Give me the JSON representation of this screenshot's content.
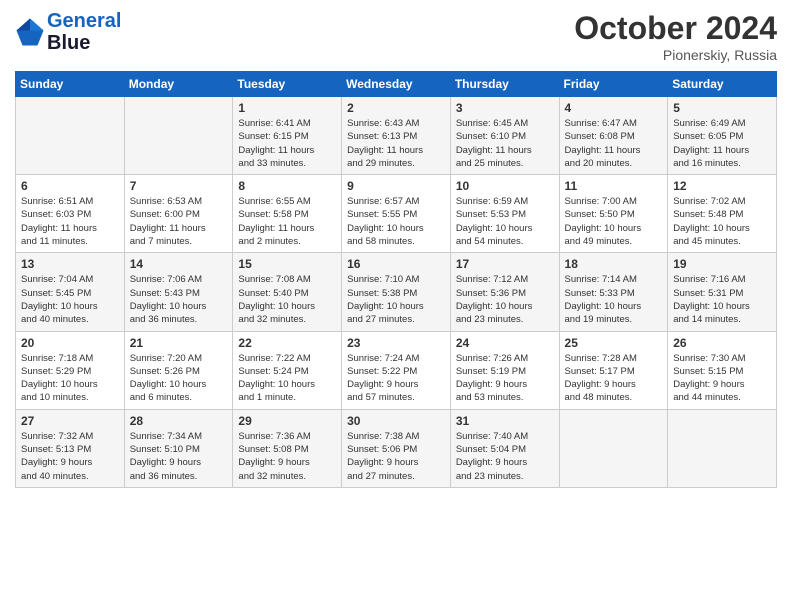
{
  "logo": {
    "line1": "General",
    "line2": "Blue"
  },
  "title": "October 2024",
  "location": "Pionerskiy, Russia",
  "days_header": [
    "Sunday",
    "Monday",
    "Tuesday",
    "Wednesday",
    "Thursday",
    "Friday",
    "Saturday"
  ],
  "weeks": [
    [
      {
        "num": "",
        "info": ""
      },
      {
        "num": "",
        "info": ""
      },
      {
        "num": "1",
        "info": "Sunrise: 6:41 AM\nSunset: 6:15 PM\nDaylight: 11 hours\nand 33 minutes."
      },
      {
        "num": "2",
        "info": "Sunrise: 6:43 AM\nSunset: 6:13 PM\nDaylight: 11 hours\nand 29 minutes."
      },
      {
        "num": "3",
        "info": "Sunrise: 6:45 AM\nSunset: 6:10 PM\nDaylight: 11 hours\nand 25 minutes."
      },
      {
        "num": "4",
        "info": "Sunrise: 6:47 AM\nSunset: 6:08 PM\nDaylight: 11 hours\nand 20 minutes."
      },
      {
        "num": "5",
        "info": "Sunrise: 6:49 AM\nSunset: 6:05 PM\nDaylight: 11 hours\nand 16 minutes."
      }
    ],
    [
      {
        "num": "6",
        "info": "Sunrise: 6:51 AM\nSunset: 6:03 PM\nDaylight: 11 hours\nand 11 minutes."
      },
      {
        "num": "7",
        "info": "Sunrise: 6:53 AM\nSunset: 6:00 PM\nDaylight: 11 hours\nand 7 minutes."
      },
      {
        "num": "8",
        "info": "Sunrise: 6:55 AM\nSunset: 5:58 PM\nDaylight: 11 hours\nand 2 minutes."
      },
      {
        "num": "9",
        "info": "Sunrise: 6:57 AM\nSunset: 5:55 PM\nDaylight: 10 hours\nand 58 minutes."
      },
      {
        "num": "10",
        "info": "Sunrise: 6:59 AM\nSunset: 5:53 PM\nDaylight: 10 hours\nand 54 minutes."
      },
      {
        "num": "11",
        "info": "Sunrise: 7:00 AM\nSunset: 5:50 PM\nDaylight: 10 hours\nand 49 minutes."
      },
      {
        "num": "12",
        "info": "Sunrise: 7:02 AM\nSunset: 5:48 PM\nDaylight: 10 hours\nand 45 minutes."
      }
    ],
    [
      {
        "num": "13",
        "info": "Sunrise: 7:04 AM\nSunset: 5:45 PM\nDaylight: 10 hours\nand 40 minutes."
      },
      {
        "num": "14",
        "info": "Sunrise: 7:06 AM\nSunset: 5:43 PM\nDaylight: 10 hours\nand 36 minutes."
      },
      {
        "num": "15",
        "info": "Sunrise: 7:08 AM\nSunset: 5:40 PM\nDaylight: 10 hours\nand 32 minutes."
      },
      {
        "num": "16",
        "info": "Sunrise: 7:10 AM\nSunset: 5:38 PM\nDaylight: 10 hours\nand 27 minutes."
      },
      {
        "num": "17",
        "info": "Sunrise: 7:12 AM\nSunset: 5:36 PM\nDaylight: 10 hours\nand 23 minutes."
      },
      {
        "num": "18",
        "info": "Sunrise: 7:14 AM\nSunset: 5:33 PM\nDaylight: 10 hours\nand 19 minutes."
      },
      {
        "num": "19",
        "info": "Sunrise: 7:16 AM\nSunset: 5:31 PM\nDaylight: 10 hours\nand 14 minutes."
      }
    ],
    [
      {
        "num": "20",
        "info": "Sunrise: 7:18 AM\nSunset: 5:29 PM\nDaylight: 10 hours\nand 10 minutes."
      },
      {
        "num": "21",
        "info": "Sunrise: 7:20 AM\nSunset: 5:26 PM\nDaylight: 10 hours\nand 6 minutes."
      },
      {
        "num": "22",
        "info": "Sunrise: 7:22 AM\nSunset: 5:24 PM\nDaylight: 10 hours\nand 1 minute."
      },
      {
        "num": "23",
        "info": "Sunrise: 7:24 AM\nSunset: 5:22 PM\nDaylight: 9 hours\nand 57 minutes."
      },
      {
        "num": "24",
        "info": "Sunrise: 7:26 AM\nSunset: 5:19 PM\nDaylight: 9 hours\nand 53 minutes."
      },
      {
        "num": "25",
        "info": "Sunrise: 7:28 AM\nSunset: 5:17 PM\nDaylight: 9 hours\nand 48 minutes."
      },
      {
        "num": "26",
        "info": "Sunrise: 7:30 AM\nSunset: 5:15 PM\nDaylight: 9 hours\nand 44 minutes."
      }
    ],
    [
      {
        "num": "27",
        "info": "Sunrise: 7:32 AM\nSunset: 5:13 PM\nDaylight: 9 hours\nand 40 minutes."
      },
      {
        "num": "28",
        "info": "Sunrise: 7:34 AM\nSunset: 5:10 PM\nDaylight: 9 hours\nand 36 minutes."
      },
      {
        "num": "29",
        "info": "Sunrise: 7:36 AM\nSunset: 5:08 PM\nDaylight: 9 hours\nand 32 minutes."
      },
      {
        "num": "30",
        "info": "Sunrise: 7:38 AM\nSunset: 5:06 PM\nDaylight: 9 hours\nand 27 minutes."
      },
      {
        "num": "31",
        "info": "Sunrise: 7:40 AM\nSunset: 5:04 PM\nDaylight: 9 hours\nand 23 minutes."
      },
      {
        "num": "",
        "info": ""
      },
      {
        "num": "",
        "info": ""
      }
    ]
  ]
}
